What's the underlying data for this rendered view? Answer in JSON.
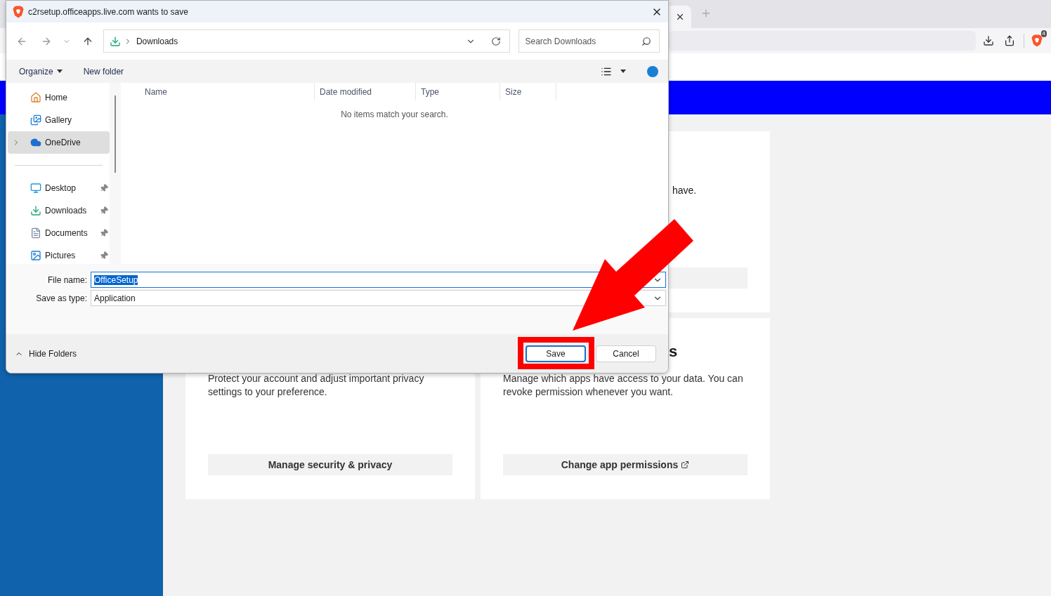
{
  "browser": {
    "extension_badge": "4"
  },
  "page": {
    "fragments": [
      {
        "kind": "text",
        "text": "have."
      },
      {
        "kind": "heading",
        "text": "s"
      }
    ],
    "cards": [
      {
        "description": "Protect your account and adjust important privacy settings to your preference.",
        "action": "Manage security & privacy",
        "external": false
      },
      {
        "description": "Manage which apps have access to your data. You can revoke permission whenever you want.",
        "action": "Change app permissions",
        "external": true
      }
    ]
  },
  "dialog": {
    "title": "c2rsetup.officeapps.live.com wants to save",
    "breadcrumb": "Downloads",
    "search": {
      "placeholder": "Search Downloads"
    },
    "toolbar": {
      "organize": "Organize",
      "new_folder": "New folder"
    },
    "nav_groups": [
      [
        {
          "label": "Home",
          "kind": "home",
          "pinned": false,
          "selected": false,
          "expandable": false
        },
        {
          "label": "Gallery",
          "kind": "gallery",
          "pinned": false,
          "selected": false,
          "expandable": false
        },
        {
          "label": "OneDrive",
          "kind": "cloud",
          "pinned": false,
          "selected": true,
          "expandable": true
        }
      ],
      [
        {
          "label": "Desktop",
          "kind": "desktop",
          "pinned": true,
          "selected": false,
          "expandable": false
        },
        {
          "label": "Downloads",
          "kind": "download",
          "pinned": true,
          "selected": false,
          "expandable": false
        },
        {
          "label": "Documents",
          "kind": "document",
          "pinned": true,
          "selected": false,
          "expandable": false
        },
        {
          "label": "Pictures",
          "kind": "picture",
          "pinned": true,
          "selected": false,
          "expandable": false
        }
      ]
    ],
    "columns": [
      "Name",
      "Date modified",
      "Type",
      "Size"
    ],
    "empty_message": "No items match your search.",
    "file_name": {
      "label": "File name:",
      "value": "OfficeSetup"
    },
    "save_type": {
      "label": "Save as type:",
      "value": "Application"
    },
    "hide_folders": "Hide Folders",
    "buttons": [
      {
        "label": "Save",
        "primary": true
      },
      {
        "label": "Cancel",
        "primary": false
      }
    ]
  }
}
